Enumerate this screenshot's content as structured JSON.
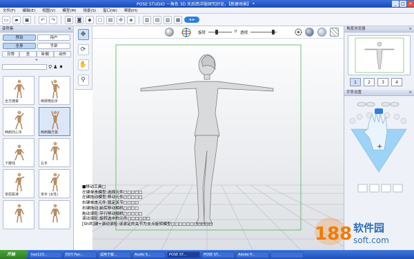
{
  "window": {
    "title": "POSE STUDIO －角色 3D 天后西洋版研究好论，【新建场景】 *"
  },
  "menu": [
    "文件(F)",
    "编辑(E)",
    "视图(V)",
    "模型(M)",
    "场景(S)",
    "窗口(W)",
    "帮助(H)"
  ],
  "toolbar": {
    "toggle_label": "◂ ▸"
  },
  "left_panel": {
    "title": "姿势集",
    "tabs": [
      "预设",
      "用户"
    ],
    "tabs2": [
      "全身",
      "手部"
    ],
    "categories": [
      "日常",
      "坐",
      "卧躺",
      "动作"
    ],
    "add_label": "+",
    "thumbnails": [
      {
        "label": "全方摊掌"
      },
      {
        "label": "两臂微抬手"
      },
      {
        "label": "两肩托心手"
      },
      {
        "label": "两肩胸方拔"
      },
      {
        "label": "下蹲线"
      },
      {
        "label": "左手"
      },
      {
        "label": "单招看准"
      },
      {
        "label": "单手 (女性)"
      },
      {
        "label": ""
      },
      {
        "label": ""
      }
    ]
  },
  "viewport_bar": {
    "rotate_label": "旋转",
    "opacity_label": "透视"
  },
  "right_panel": {
    "title1": "角度浏览器",
    "views": [
      "1",
      "2",
      "3",
      "4"
    ],
    "title2": "手势设置",
    "plus": "+"
  },
  "help": {
    "lines": [
      "■移动工具□",
      "左键单击模型:选择元件□□□□□",
      "左键拖动模型:移动元件□□□□□",
      "右键单击元件:锁定关节□□□□",
      "右键拖动:前后移动相机□□□□",
      "拖动滚轮:平行移动相机□□□□□",
      "滚动滚轮:旋转选中的元件□□□□□□",
      "[Shift]键+滚动滚轮:该滚定的关节为支点旋转模型□□□□□□□□□□□"
    ]
  },
  "taskbar": {
    "start": "开始",
    "tasks": [
      "hao123...",
      "ESTI Fan...",
      "试用下载...",
      "Audio S...",
      "POSE ST...",
      "POSE ST...",
      "Adobe P...",
      ""
    ]
  },
  "watermark": {
    "number": "188",
    "cn": "软件园",
    "url": "soft.com"
  },
  "colors": {
    "accent": "#2d7fe0",
    "title_bar": "#1a4ab8",
    "selection": "#bcd3f2",
    "bbox": "#53b153"
  }
}
